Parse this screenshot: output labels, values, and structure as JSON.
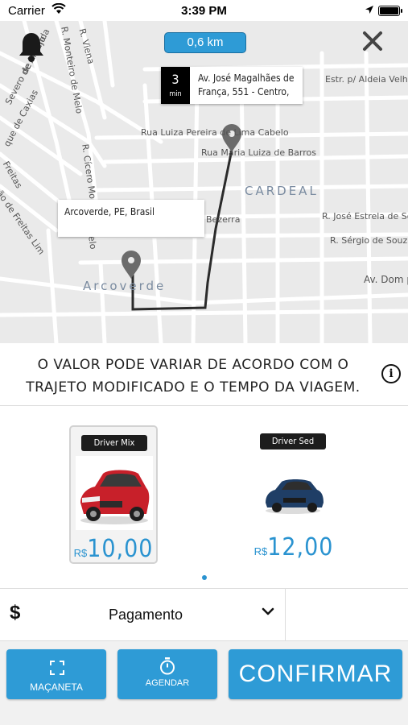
{
  "status_bar": {
    "carrier": "Carrier",
    "time": "3:39 PM"
  },
  "map": {
    "distance": "0,6 km",
    "destination": {
      "eta_value": "3",
      "eta_unit": "min",
      "address": "Av. José Magalhães de França, 551 - Centro,"
    },
    "origin": {
      "address": "Arcoverde, PE, Brasil"
    },
    "streets": {
      "viena": "R. Viena",
      "monteiro_melo": "R. Monteiro de Melo",
      "miranda": "de Miranda",
      "severo_araujo": "Severo de Araujo",
      "caxias": "que de Caxias",
      "freitas": "Freitas",
      "freitas_lim": "ão de Freitas Lim",
      "cicero": "R. Cícero Mo",
      "elo": "elo",
      "luiza_pereira": "Rua Luiza Pereira de Lima Cabelo",
      "maria_luiza": "Rua Maria Luiza de Barros",
      "aldeia_velha": "Estr. p/ Aldeia Velha",
      "bezerra": "Bezerra",
      "jose_estrela": "R. José Estrela de Souza",
      "sergio_souza": "R. Sérgio de Souza",
      "av_dom": "Av. Dom p"
    },
    "districts": {
      "cardeal": "CARDEAL",
      "arcoverde": "Arcoverde"
    }
  },
  "notice": {
    "text": "O VALOR PODE VARIAR DE ACORDO COM O TRAJETO MODIFICADO E O TEMPO DA VIAGEM."
  },
  "vehicles": [
    {
      "name": "Driver Mix",
      "currency": "R$",
      "price": "10,00",
      "selected": true,
      "color": "#c8202a"
    },
    {
      "name": "Driver Sed",
      "currency": "R$",
      "price": "12,00",
      "selected": false,
      "color": "#1f3e66"
    }
  ],
  "payment": {
    "symbol": "$",
    "label": "Pagamento"
  },
  "actions": {
    "macaneta": "MAÇANETA",
    "agendar": "AGENDAR",
    "confirmar": "CONFIRMAR"
  },
  "colors": {
    "accent": "#2e9bd6",
    "price": "#2a93d0",
    "map_bg": "#eaeaea"
  }
}
